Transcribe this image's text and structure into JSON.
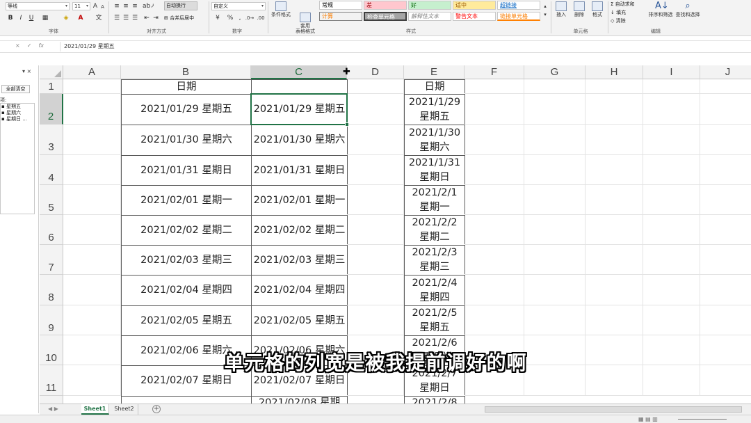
{
  "ribbon": {
    "font_name": "等线",
    "font_size": "11",
    "font_buttons": [
      "B",
      "I",
      "U"
    ],
    "wrap_text": "自动换行",
    "merge_center": "合并后居中",
    "number_format": "自定义",
    "percent": "%",
    "comma": ",",
    "conditional_format": "条件格式",
    "format_as_table": "套用\n表格格式",
    "styles": {
      "normal": "常规",
      "bad": "差",
      "good": "好",
      "neutral": "适中",
      "hyperlink": "超链接",
      "calculation": "计算",
      "check_cell": "检查单元格",
      "explanatory": "解释性文本",
      "warning": "警告文本",
      "followed_link": "链接单元格"
    },
    "insert": "插入",
    "delete": "删除",
    "format": "格式",
    "autosum": "自动求和",
    "fill": "填充",
    "clear": "清除",
    "sort_filter": "排序和筛选",
    "find_select": "查找和选择",
    "group_labels": {
      "font": "字体",
      "alignment": "对齐方式",
      "number": "数字",
      "styles": "样式",
      "cells": "单元格",
      "editing": "编辑"
    },
    "colors": {
      "bad_bg": "#ffc7ce",
      "bad_fg": "#9c0006",
      "good_bg": "#c6efce",
      "good_fg": "#006100",
      "neutral_bg": "#ffeb9c",
      "neutral_fg": "#9c5700",
      "calc_bg": "#f2f2f2",
      "calc_fg": "#fa7d00",
      "check_bg": "#a5a5a5",
      "check_fg": "#ffffff",
      "link_fg": "#0563c1",
      "warn_fg": "#ff0000",
      "followed_fg": "#fa7d00"
    }
  },
  "formula_bar": {
    "cancel_icon": "×",
    "confirm_icon": "✓",
    "fx_icon": "fx",
    "formula": "2021/01/29 星期五"
  },
  "side_panel": {
    "close_icons": "▾ ×",
    "clear_all": "全部清空",
    "items_label": "项:",
    "items": [
      "星期五",
      "星期六",
      "星期日 ..."
    ]
  },
  "sheet": {
    "columns": [
      "A",
      "B",
      "C",
      "D",
      "E",
      "F",
      "G",
      "H",
      "I",
      "J"
    ],
    "rows": [
      "1",
      "2",
      "3",
      "4",
      "5",
      "6",
      "7",
      "8",
      "9",
      "10",
      "11"
    ],
    "selected_column": "C",
    "selected_row": "2",
    "cells": {
      "B": [
        "日期",
        "2021/01/29 星期五",
        "2021/01/30 星期六",
        "2021/01/31 星期日",
        "2021/02/01 星期一",
        "2021/02/02 星期二",
        "2021/02/03 星期三",
        "2021/02/04 星期四",
        "2021/02/05 星期五",
        "2021/02/06 星期六",
        "2021/02/07 星期日"
      ],
      "C": [
        "",
        "2021/01/29 星期五",
        "2021/01/30 星期六",
        "2021/01/31 星期日",
        "2021/02/01 星期一",
        "2021/02/02 星期二",
        "2021/02/03 星期三",
        "2021/02/04 星期四",
        "2021/02/05 星期五",
        "2021/02/06 星期六",
        "2021/02/07 星期日"
      ],
      "E": [
        "日期",
        "2021/1/29\n星期五",
        "2021/1/30\n星期六",
        "2021/1/31\n星期日",
        "2021/2/1\n星期一",
        "2021/2/2\n星期二",
        "2021/2/3\n星期三",
        "2021/2/4\n星期四",
        "2021/2/5\n星期五",
        "2021/2/6\n星期六",
        "2021/2/7\n星期日"
      ]
    },
    "partial_row": {
      "C": "2021/02/08 星期",
      "E": "2021/2/8"
    }
  },
  "tabs": {
    "sheets": [
      "Sheet1",
      "Sheet2"
    ],
    "active": "Sheet1",
    "add_icon": "+",
    "nav_icons": "◀ ▶"
  },
  "subtitle": "单元格的列宽是被我提前调好的啊"
}
